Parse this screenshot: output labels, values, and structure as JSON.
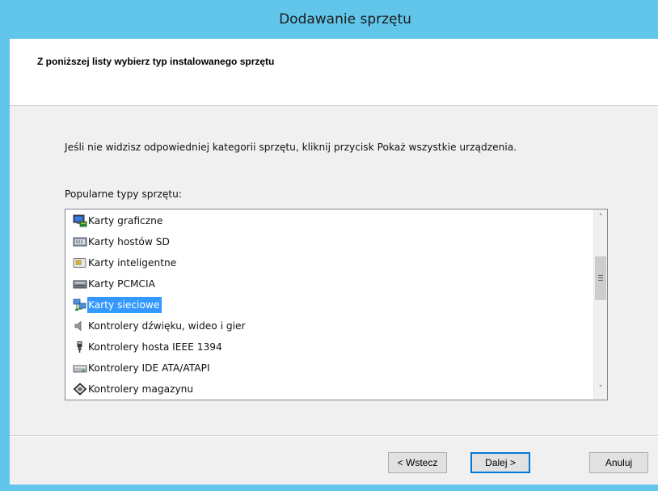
{
  "window": {
    "title": "Dodawanie sprzętu"
  },
  "header": {
    "instruction": "Z poniższej listy wybierz typ instalowanego sprzętu"
  },
  "body": {
    "description": "Jeśli nie widzisz odpowiedniej kategorii sprzętu, kliknij przycisk Pokaż wszystkie urządzenia.",
    "list_label": "Popularne typy sprzętu:"
  },
  "hardware_list": {
    "items": [
      {
        "label": "Karty graficzne",
        "icon": "display-adapter-icon",
        "selected": false
      },
      {
        "label": "Karty hostów SD",
        "icon": "sd-host-icon",
        "selected": false
      },
      {
        "label": "Karty inteligentne",
        "icon": "smart-card-icon",
        "selected": false
      },
      {
        "label": "Karty PCMCIA",
        "icon": "pcmcia-card-icon",
        "selected": false
      },
      {
        "label": "Karty sieciowe",
        "icon": "network-adapter-icon",
        "selected": true
      },
      {
        "label": "Kontrolery dźwięku, wideo i gier",
        "icon": "speaker-icon",
        "selected": false
      },
      {
        "label": "Kontrolery hosta IEEE 1394",
        "icon": "firewire-plug-icon",
        "selected": false
      },
      {
        "label": "Kontrolery IDE ATA/ATAPI",
        "icon": "ide-drive-icon",
        "selected": false
      },
      {
        "label": "Kontrolery magazynu",
        "icon": "storage-controller-icon",
        "selected": false
      }
    ],
    "selection_color": "#3399ff"
  },
  "scrollbar": {
    "up_glyph": "˄",
    "down_glyph": "˅"
  },
  "buttons": {
    "back": "< Wstecz",
    "next": "Dalej >",
    "cancel": "Anuluj"
  },
  "colors": {
    "frame": "#62c6ea",
    "client": "#f0f0f0",
    "default_button_border": "#0078d7"
  }
}
